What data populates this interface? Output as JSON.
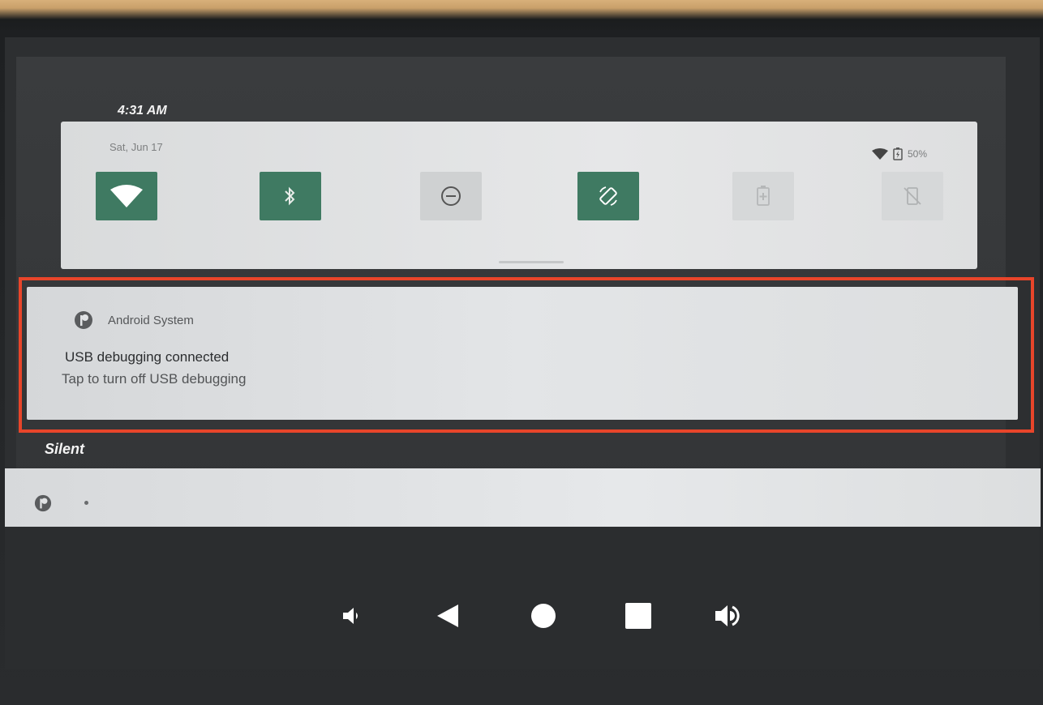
{
  "status": {
    "time": "4:31 AM",
    "date": "Sat, Jun 17",
    "battery_text": "50%"
  },
  "quick_settings": {
    "tiles": [
      {
        "icon": "wifi-icon",
        "state": "on"
      },
      {
        "icon": "bluetooth-icon",
        "state": "on"
      },
      {
        "icon": "do-not-disturb-icon",
        "state": "off"
      },
      {
        "icon": "auto-rotate-icon",
        "state": "on"
      },
      {
        "icon": "battery-saver-icon",
        "state": "disabled"
      },
      {
        "icon": "screen-rotation-off-icon",
        "state": "disabled"
      }
    ]
  },
  "notification": {
    "app_name": "Android System",
    "title": "USB debugging connected",
    "text": "Tap to turn off USB debugging"
  },
  "silent_section": {
    "label": "Silent"
  },
  "nav": {
    "buttons": [
      "volume-down-icon",
      "back-icon",
      "home-icon",
      "recents-icon",
      "volume-up-icon"
    ]
  },
  "colors": {
    "tile_on": "#3f7a62",
    "highlight": "#e8452a"
  }
}
